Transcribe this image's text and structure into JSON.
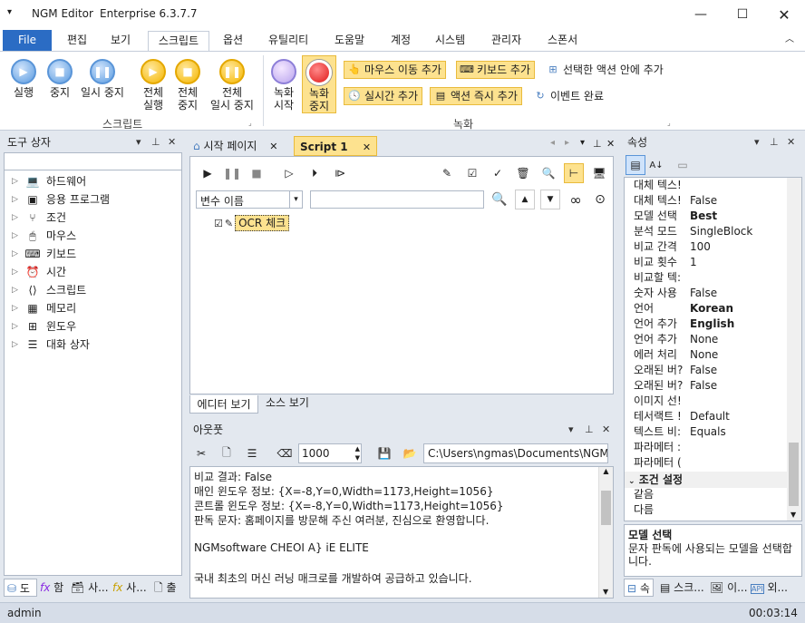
{
  "app": {
    "title": "NGM Editor",
    "edition": "Enterprise 6.3.7.7",
    "menu_icon": "chevron-down-icon"
  },
  "tabs": [
    "File",
    "편집",
    "보기",
    "스크립트",
    "옵션",
    "유틸리티",
    "도움말",
    "계정",
    "시스템",
    "관리자",
    "스폰서"
  ],
  "ribbon": {
    "script_group": "스크립트",
    "record_group": "녹화",
    "btn_run": "실행",
    "btn_stop": "중지",
    "btn_pause": "일시 중지",
    "btn_run_all_1": "전체",
    "btn_run_all_2": "실행",
    "btn_stop_all_1": "전체",
    "btn_stop_all_2": "중지",
    "btn_pause_all_1": "전체",
    "btn_pause_all_2": "일시 중지",
    "btn_rec_start_1": "녹화",
    "btn_rec_start_2": "시작",
    "btn_rec_stop_1": "녹화",
    "btn_rec_stop_2": "중지",
    "add_mouse": "마우스 이동 추가",
    "add_keyboard": "키보드 추가",
    "add_in_selected": "선택한 액션 안에 추가",
    "add_realtime": "실시간 추가",
    "add_action_now": "액션 즉시 추가",
    "event_done": "이벤트 완료"
  },
  "toolbox": {
    "title": "도구 상자",
    "items": [
      "하드웨어",
      "응용 프로그램",
      "조건",
      "마우스",
      "키보드",
      "시간",
      "스크립트",
      "메모리",
      "윈도우",
      "대화 상자"
    ],
    "bottom_tabs": [
      "도",
      "함",
      "사...",
      "사...",
      "출"
    ]
  },
  "editor": {
    "tabs": [
      "시작 페이지",
      "Script 1"
    ],
    "var_select": "변수 이름",
    "node": "OCR 체크",
    "bottom_tabs": [
      "에디터 보기",
      "소스 보기"
    ]
  },
  "output": {
    "title": "아웃풋",
    "number": "1000",
    "path": "C:\\Users\\ngmas\\Documents\\NGM6\\",
    "lines": [
      "비교 결과: False",
      "매인 윈도우 정보: {X=-8,Y=0,Width=1173,Height=1056}",
      "콘트롤 윈도우 정보: {X=-8,Y=0,Width=1173,Height=1056}",
      "판독 문자: 홈페이지를 방문해 주신 여러분, 진심으로 환영합니다.",
      "",
      "NGMsoftware CHEOI A} iE ELITE",
      "",
      "국내 최초의 머신 러닝 매크로를 개발하여 공급하고 있습니다."
    ]
  },
  "properties": {
    "title": "속성",
    "rows": [
      {
        "k": "대체 텍스!",
        "v": "",
        "b": false
      },
      {
        "k": "대체 텍스!",
        "v": "False",
        "b": false
      },
      {
        "k": "모델 선택",
        "v": "Best",
        "b": true
      },
      {
        "k": "분석 모드",
        "v": "SingleBlock",
        "b": false
      },
      {
        "k": "비교 간격",
        "v": "100",
        "b": false
      },
      {
        "k": "비교 횟수",
        "v": "1",
        "b": false
      },
      {
        "k": "비교할 텍:",
        "v": "",
        "b": false
      },
      {
        "k": "숫자 사용",
        "v": "False",
        "b": false
      },
      {
        "k": "언어",
        "v": "Korean",
        "b": true
      },
      {
        "k": "언어 추가",
        "v": "English",
        "b": true
      },
      {
        "k": "언어 추가",
        "v": "None",
        "b": false
      },
      {
        "k": "에러 처리",
        "v": "None",
        "b": false
      },
      {
        "k": "오래된 버?",
        "v": "False",
        "b": false
      },
      {
        "k": "오래된 버?",
        "v": "False",
        "b": false
      },
      {
        "k": "이미지 선!",
        "v": "",
        "b": false
      },
      {
        "k": "테서랙트 !",
        "v": "Default",
        "b": false
      },
      {
        "k": "텍스트 비:",
        "v": "Equals",
        "b": false
      },
      {
        "k": "파라메터 :",
        "v": "",
        "b": false
      },
      {
        "k": "파라메터 (",
        "v": "",
        "b": false
      }
    ],
    "section": "조건 설정",
    "section_rows": [
      "같음",
      "다름"
    ],
    "desc_title": "모델 선택",
    "desc_text": "문자 판독에 사용되는 모델을 선택합니다.",
    "bottom_tabs": [
      "속",
      "스크...",
      "이...",
      "외..."
    ]
  },
  "status": {
    "user": "admin",
    "time": "00:03:14"
  }
}
